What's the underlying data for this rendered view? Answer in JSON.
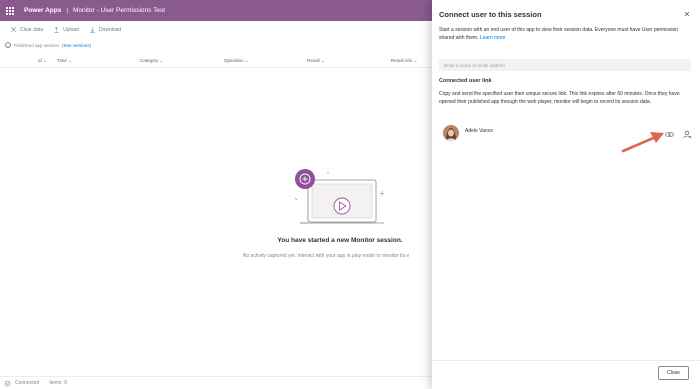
{
  "titlebar": {
    "app_name": "Power Apps",
    "separator": "|",
    "doc_title": "Monitor - User Permissions Test"
  },
  "toolbar": {
    "clear_label": "Clear data",
    "upload_label": "Upload",
    "download_label": "Download"
  },
  "infobar": {
    "text": "Published app session",
    "link": "(See versions)"
  },
  "columns": [
    "Id",
    "Time",
    "Category",
    "Operation",
    "Result",
    "Result info"
  ],
  "empty_state": {
    "title": "You have started a new Monitor session.",
    "subtitle": "No activity captured yet. Interact with your app in play mode to monitor its e"
  },
  "statusbar": {
    "connection": "Connected",
    "items": "Items: 0"
  },
  "panel": {
    "title": "Connect user to this session",
    "description": "Start a session with an end user of this app to view their session data. Everyone must have User permission shared with them.",
    "learn_more": "Learn more",
    "input_placeholder": "Enter a name or email address",
    "section_title": "Connected user link",
    "section_desc": "Copy and send the specified user their unique secure link. This link expires after 60 minutes. Once they have opened their published app through the web player, monitor will begin to record its session data.",
    "user_name": "Adele Vance",
    "close_label": "Close"
  },
  "colors": {
    "titlebar": "#8a5a8e",
    "accent_purple": "#8f4f9b",
    "link": "#0078d4",
    "arrow": "#e0664b"
  }
}
